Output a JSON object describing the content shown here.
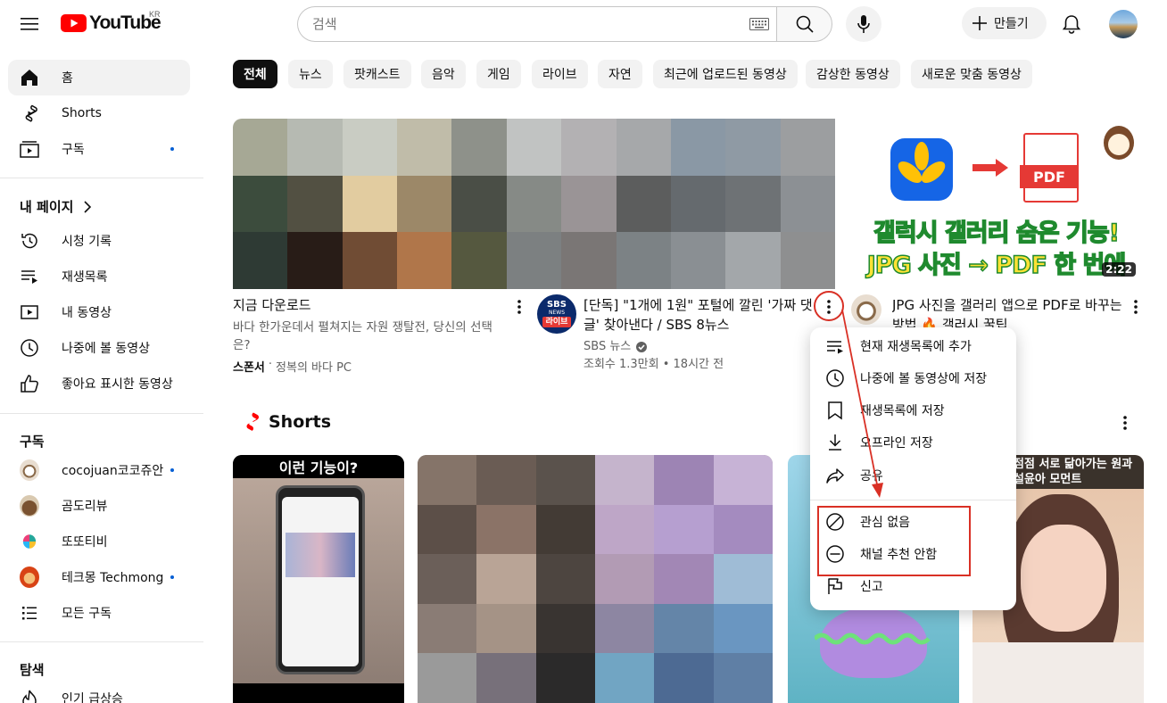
{
  "header": {
    "logo_text": "YouTube",
    "logo_region": "KR",
    "search_placeholder": "검색",
    "create_label": "만들기"
  },
  "sidebar": {
    "main": [
      {
        "label": "홈",
        "icon": "home-icon",
        "active": true
      },
      {
        "label": "Shorts",
        "icon": "shorts-icon"
      },
      {
        "label": "구독",
        "icon": "subscriptions-icon",
        "dot": true
      }
    ],
    "my_page_title": "내 페이지",
    "my_page": [
      {
        "label": "시청 기록",
        "icon": "history-icon"
      },
      {
        "label": "재생목록",
        "icon": "playlist-icon"
      },
      {
        "label": "내 동영상",
        "icon": "my-videos-icon"
      },
      {
        "label": "나중에 볼 동영상",
        "icon": "watch-later-icon"
      },
      {
        "label": "좋아요 표시한 동영상",
        "icon": "like-icon"
      }
    ],
    "subs_title": "구독",
    "subs": [
      {
        "label": "cocojuan코코쥬안",
        "dot": true
      },
      {
        "label": "곰도리뷰"
      },
      {
        "label": "또또티비"
      },
      {
        "label": "테크몽 Techmong",
        "dot": true
      },
      {
        "label": "모든 구독"
      }
    ],
    "explore_title": "탐색",
    "explore": [
      {
        "label": "인기 급상승",
        "icon": "trending-icon"
      }
    ]
  },
  "chips": [
    "전체",
    "뉴스",
    "팟캐스트",
    "음악",
    "게임",
    "라이브",
    "자연",
    "최근에 업로드된 동영상",
    "감상한 동영상",
    "새로운 맞춤 동영상"
  ],
  "videos": {
    "ad": {
      "title": "지금 다운로드",
      "desc": "바다 한가운데서 펼쳐지는 자원 쟁탈전, 당신의 선택은?",
      "sponsor": "스폰서",
      "advertiser": "정복의 바다 PC"
    },
    "news": {
      "channel_badge_top": "SBS",
      "channel_badge_mid": "NEWS",
      "channel_badge_live": "라이브",
      "title": "[단독] \"1개에 1원\" 포털에 깔린 '가짜 댓글' 찾아낸다 / SBS 8뉴스",
      "channel": "SBS 뉴스",
      "stats": "조회수 1.3만회 • 18시간 전"
    },
    "pdf": {
      "pdf_label": "PDF",
      "headline1": "갤럭시 갤러리 숨은 기능!",
      "headline2": "JPG 사진 → PDF 한 번에",
      "duration": "2:22",
      "title": "JPG 사진을 갤러리 앱으로 PDF로 바꾸는 방법 🔥 갤러시 꿀팁"
    }
  },
  "shorts": {
    "title": "Shorts",
    "items": [
      {
        "caption": "이런 기능이?"
      },
      {
        "caption": ""
      },
      {
        "caption": ""
      },
      {
        "caption": ""
      },
      {
        "caption": "점점 서로 닮아가는 원과 설윤아 모먼트"
      }
    ]
  },
  "context_menu": {
    "items": [
      {
        "label": "현재 재생목록에 추가",
        "icon": "add-to-queue-icon"
      },
      {
        "label": "나중에 볼 동영상에 저장",
        "icon": "clock-icon"
      },
      {
        "label": "재생목록에 저장",
        "icon": "bookmark-icon"
      },
      {
        "label": "오프라인 저장",
        "icon": "download-icon"
      },
      {
        "label": "공유",
        "icon": "share-icon"
      },
      {
        "label": "관심 없음",
        "icon": "not-interested-icon"
      },
      {
        "label": "채널 추천 안함",
        "icon": "dont-recommend-icon"
      },
      {
        "label": "신고",
        "icon": "flag-icon"
      }
    ]
  },
  "colors": {
    "brand_red": "#ff0000",
    "annotation_red": "#d93025",
    "accent_blue": "#065fd4"
  }
}
